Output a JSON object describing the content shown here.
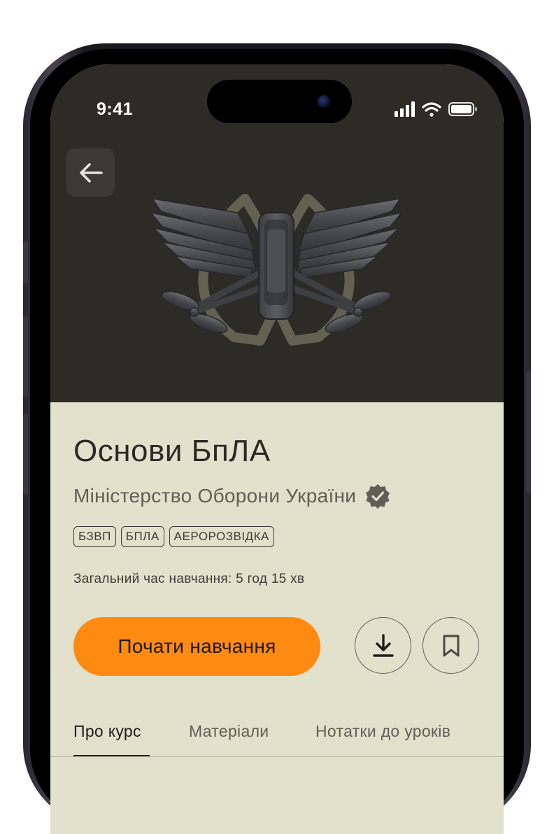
{
  "status_bar": {
    "time": "9:41"
  },
  "course": {
    "title": "Основи БпЛА",
    "publisher": "Міністерство Оборони України",
    "tags": [
      "БЗВП",
      "БПЛА",
      "АЕРОРОЗВІДКА"
    ],
    "duration": "Загальний час навчання: 5 год 15 хв"
  },
  "actions": {
    "start_label": "Почати навчання"
  },
  "tabs": [
    {
      "label": "Про курс",
      "active": true
    },
    {
      "label": "Матеріали",
      "active": false
    },
    {
      "label": "Нотатки до уроків",
      "active": false
    }
  ],
  "colors": {
    "hero_background": "#2c2b25",
    "content_background": "#e2e1cc",
    "accent": "#ff8a12"
  },
  "icons": [
    "arrow-left-icon",
    "verified-badge-icon",
    "download-icon",
    "bookmark-icon",
    "signal-icon",
    "wifi-icon",
    "battery-icon"
  ]
}
